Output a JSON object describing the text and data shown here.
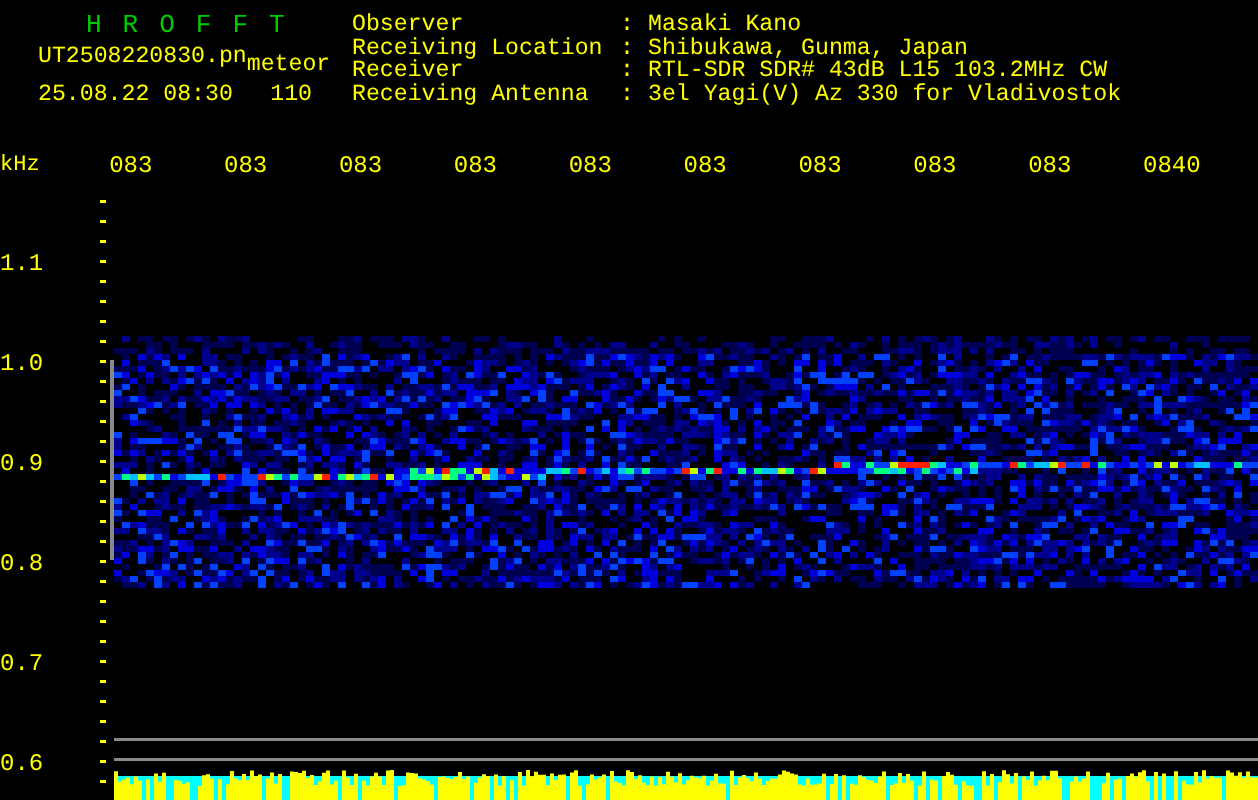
{
  "app": {
    "title": "HROFFT",
    "file": "UT2508220830.pn",
    "mode": "meteor",
    "datetime": "25.08.22 08:30",
    "count": "110"
  },
  "observer": {
    "label": "Observer",
    "separator": ":",
    "value": "Masaki Kano"
  },
  "station": [
    {
      "label": "Receiving Location",
      "separator": ":",
      "value": "Shibukawa, Gunma, Japan"
    },
    {
      "label": "Receiver",
      "separator": ":",
      "value": "RTL-SDR SDR# 43dB L15 103.2MHz CW"
    },
    {
      "label": "Receiving Antenna",
      "separator": ":",
      "value": "3el Yagi(V) Az 330 for Vladivostok"
    }
  ],
  "time_axis": {
    "labels": [
      "083",
      "083",
      "083",
      "083",
      "083",
      "083",
      "083",
      "083",
      "083",
      "0840"
    ]
  },
  "frequency_axis": {
    "unit": "kHz",
    "labels": [
      "1.1",
      "1.0",
      "0.9",
      "0.8",
      "0.7",
      "0.6"
    ]
  }
}
